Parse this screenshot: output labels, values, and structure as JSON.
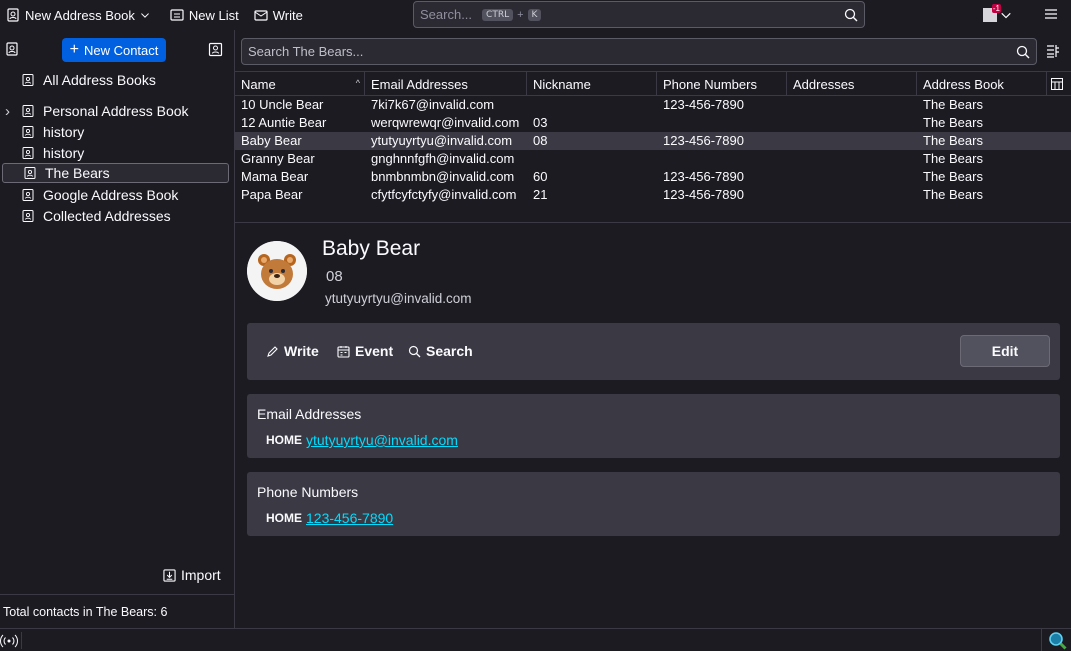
{
  "toolbar": {
    "new_address_book": "New Address Book",
    "new_list": "New List",
    "write": "Write",
    "search_placeholder": "Search...",
    "shortcut_ctrl": "CTRL",
    "shortcut_plus": "+",
    "shortcut_key": "K",
    "badge": "-1"
  },
  "sidebar": {
    "new_contact": "New Contact",
    "items": [
      {
        "label": "All Address Books",
        "twisty": ""
      },
      {
        "label": "Personal Address Book",
        "twisty": "›"
      },
      {
        "label": "history",
        "twisty": ""
      },
      {
        "label": "history",
        "twisty": ""
      },
      {
        "label": "The Bears",
        "twisty": ""
      },
      {
        "label": "Google Address Book",
        "twisty": ""
      },
      {
        "label": "Collected Addresses",
        "twisty": ""
      }
    ],
    "import": "Import",
    "total": "Total contacts in The Bears: 6"
  },
  "list": {
    "search_placeholder": "Search The Bears...",
    "columns": [
      "Name",
      "Email Addresses",
      "Nickname",
      "Phone Numbers",
      "Addresses",
      "Address Book"
    ],
    "rows": [
      {
        "name": "10 Uncle Bear",
        "email": "7ki7k67@invalid.com",
        "nickname": "",
        "phone": "123-456-7890",
        "address": "",
        "book": "The Bears"
      },
      {
        "name": "12 Auntie Bear",
        "email": "werqwrewqr@invalid.com",
        "nickname": "03",
        "phone": "",
        "address": "",
        "book": "The Bears"
      },
      {
        "name": "Baby Bear",
        "email": "ytutyuyrtyu@invalid.com",
        "nickname": "08",
        "phone": "123-456-7890",
        "address": "",
        "book": "The Bears"
      },
      {
        "name": "Granny Bear",
        "email": "gnghnnfgfh@invalid.com",
        "nickname": "",
        "phone": "",
        "address": "",
        "book": "The Bears"
      },
      {
        "name": "Mama Bear",
        "email": "bnmbnmbn@invalid.com",
        "nickname": "60",
        "phone": "123-456-7890",
        "address": "",
        "book": "The Bears"
      },
      {
        "name": "Papa Bear",
        "email": "cfytfcyfctyfy@invalid.com",
        "nickname": "21",
        "phone": "123-456-7890",
        "address": "",
        "book": "The Bears"
      }
    ]
  },
  "card": {
    "name": "Baby Bear",
    "nickname": "08",
    "email": "ytutyuyrtyu@invalid.com",
    "actions": {
      "write": "Write",
      "event": "Event",
      "search": "Search",
      "edit": "Edit"
    },
    "email_section": {
      "title": "Email Addresses",
      "type": "HOME",
      "value": "ytutyuyrtyu@invalid.com"
    },
    "phone_section": {
      "title": "Phone Numbers",
      "type": "HOME",
      "value": "123-456-7890"
    }
  },
  "colors": {
    "accent": "#0060df",
    "link": "#00ddff",
    "background": "#1c1b22"
  }
}
